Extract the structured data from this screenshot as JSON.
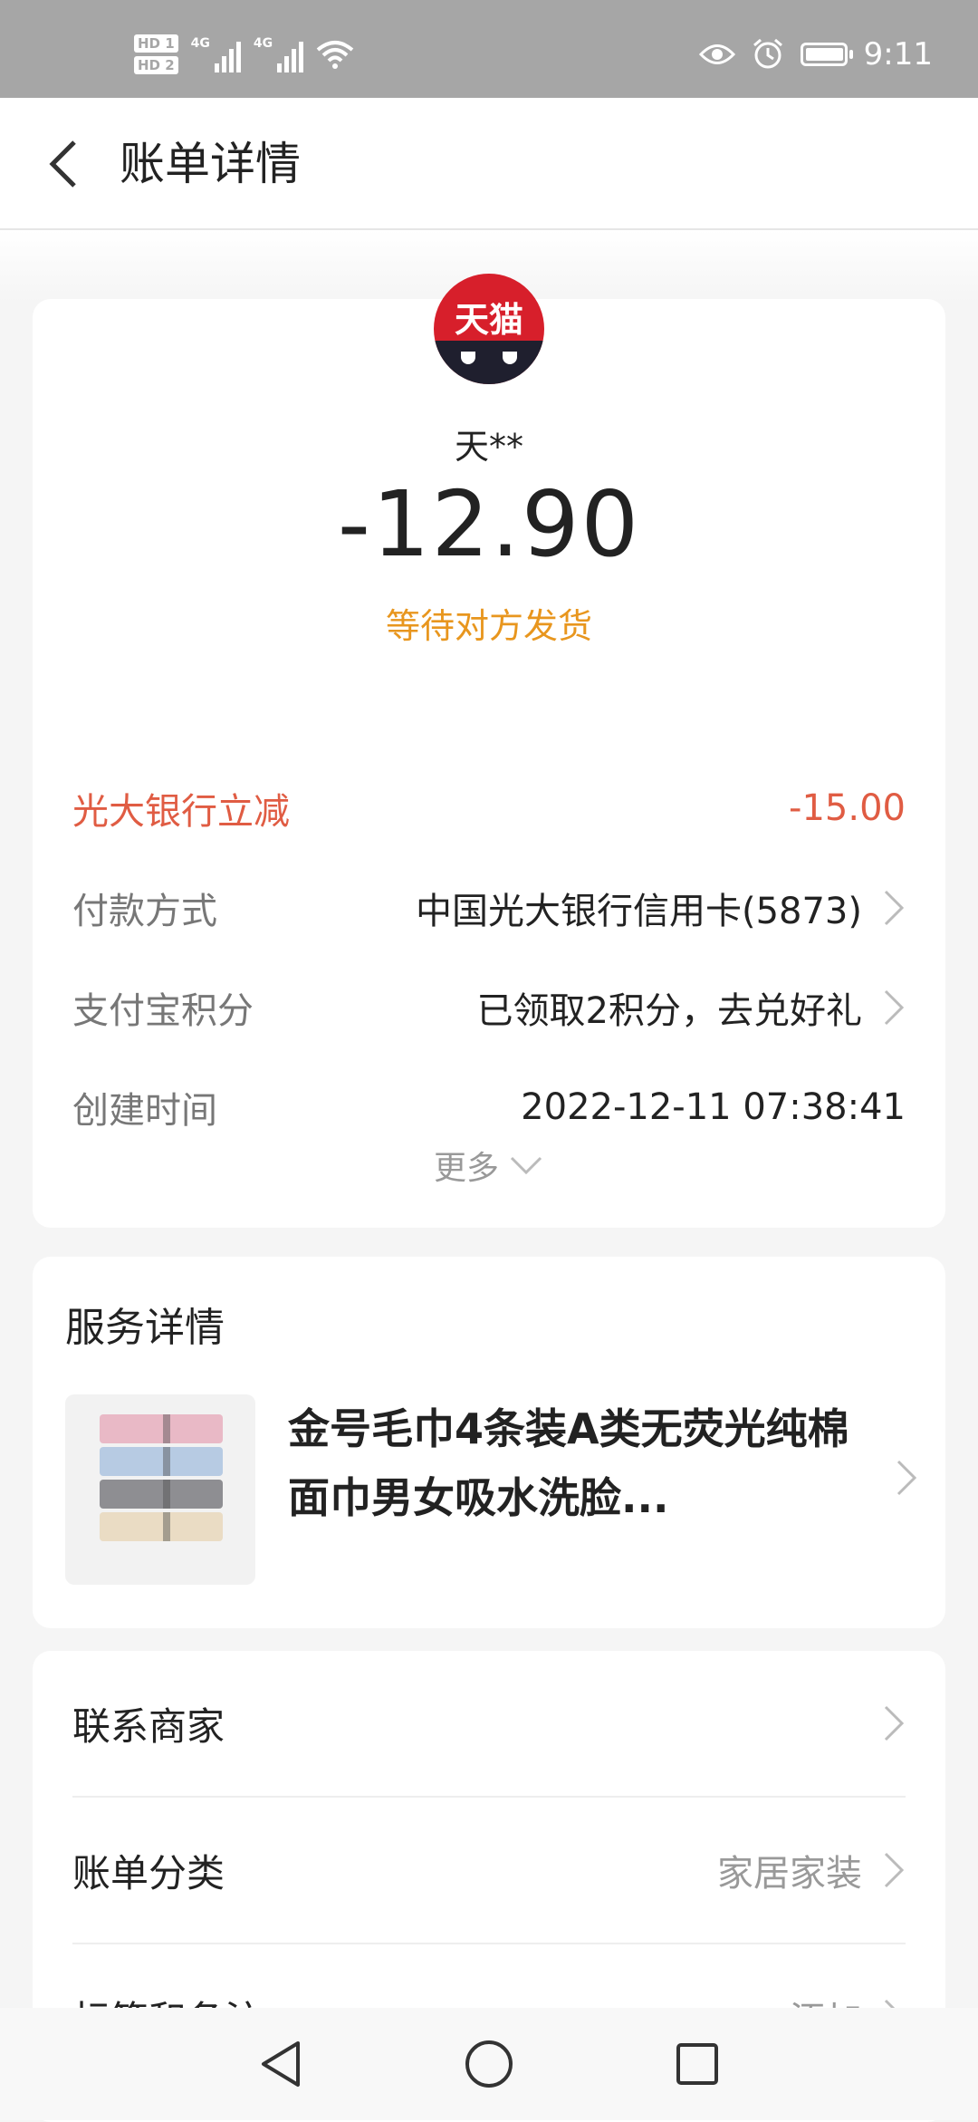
{
  "status_bar": {
    "time": "9:11",
    "sim1": "HD 1",
    "sim2": "HD 2",
    "network1": "4G",
    "network2": "4G",
    "icons": [
      "eye-icon",
      "alarm-icon",
      "wifi-icon",
      "battery-icon"
    ],
    "battery_level": 0.9
  },
  "header": {
    "title": "账单详情",
    "back_icon": "chevron-left-icon"
  },
  "bill": {
    "merchant_logo_text": "天猫",
    "merchant_name": "天**",
    "amount": "-12.90",
    "status": "等待对方发货",
    "discount_label": "光大银行立减",
    "discount_value": "-15.00",
    "payment_label": "付款方式",
    "payment_value": "中国光大银行信用卡(5873)",
    "points_label": "支付宝积分",
    "points_value": "已领取2积分，去兑好礼",
    "created_label": "创建时间",
    "created_value": "2022-12-11 07:38:41",
    "more_label": "更多"
  },
  "service": {
    "title": "服务详情",
    "product_title": "金号毛巾4条装A类无荧光纯棉面巾男女吸水洗脸..."
  },
  "actions": {
    "contact_label": "联系商家",
    "category_label": "账单分类",
    "category_value": "家居家装",
    "tags_label": "标签和备注",
    "tags_value": "添加"
  },
  "colors": {
    "accent_orange": "#e8961e",
    "discount_red": "#e05c43",
    "logo_red": "#d71f2b"
  }
}
